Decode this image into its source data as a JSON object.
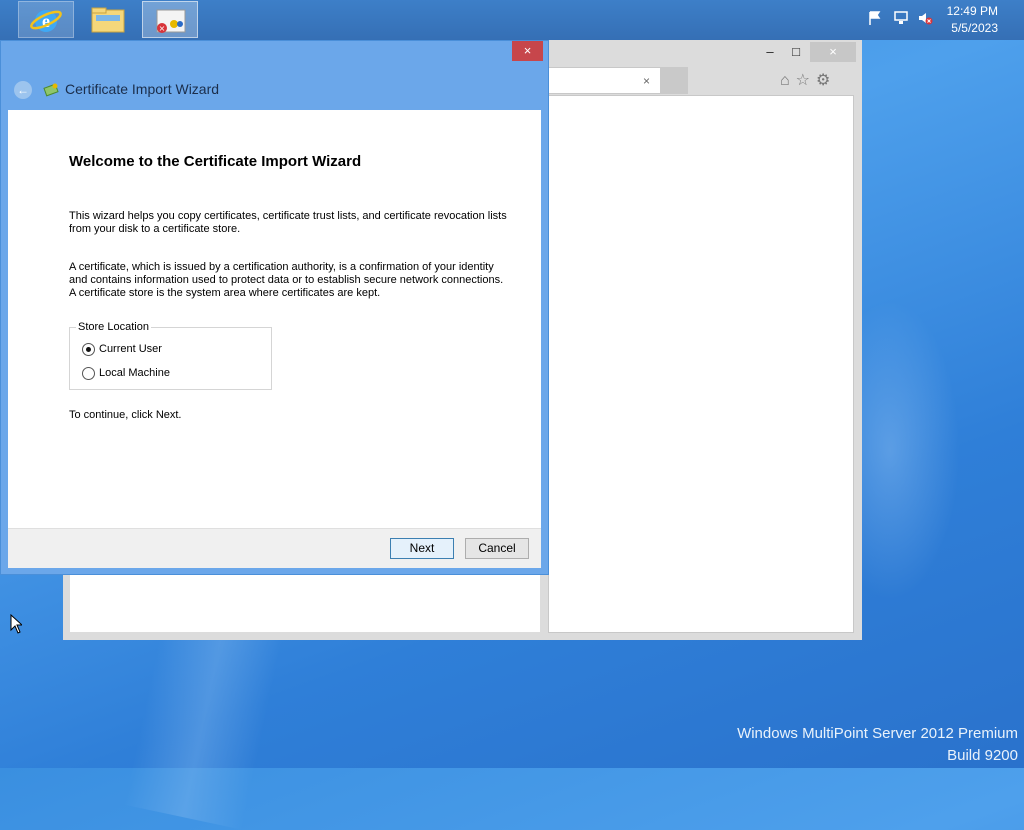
{
  "taskbar": {
    "pinned": [
      {
        "name": "internet-explorer-icon"
      },
      {
        "name": "file-explorer-icon"
      },
      {
        "name": "certificate-wizard-icon"
      }
    ],
    "clock": {
      "time": "12:49 PM",
      "date": "5/5/2023"
    },
    "tray_icons": [
      "action-center-flag-icon",
      "network-icon",
      "volume-muted-icon"
    ]
  },
  "background_window": {
    "tab_close": "×",
    "nav_icons": [
      "home-icon",
      "favorites-star-icon",
      "settings-gear-icon"
    ],
    "controls": {
      "minimize": "–",
      "maximize": "□",
      "close": "×"
    }
  },
  "wizard": {
    "title": "Certificate Import Wizard",
    "close_label": "×",
    "back_label": "←",
    "heading": "Welcome to the Certificate Import Wizard",
    "paragraph1": "This wizard helps you copy certificates, certificate trust lists, and certificate revocation lists from your disk to a certificate store.",
    "paragraph2": "A certificate, which is issued by a certification authority, is a confirmation of your identity and contains information used to protect data or to establish secure network connections. A certificate store is the system area where certificates are kept.",
    "store_location": {
      "label": "Store Location",
      "options": [
        {
          "label": "Current User",
          "selected": true
        },
        {
          "label": "Local Machine",
          "selected": false
        }
      ]
    },
    "continue_text": "To continue, click Next.",
    "buttons": {
      "next": "Next",
      "cancel": "Cancel"
    }
  },
  "desktop_watermark": {
    "line1": "Windows MultiPoint Server 2012 Premium",
    "line2": "Build 9200"
  },
  "colors": {
    "desktop": "#3a8fe0",
    "taskbar": "#3d7fc8",
    "wizard_frame": "#6ba7ea",
    "close_button": "#c7464b"
  }
}
